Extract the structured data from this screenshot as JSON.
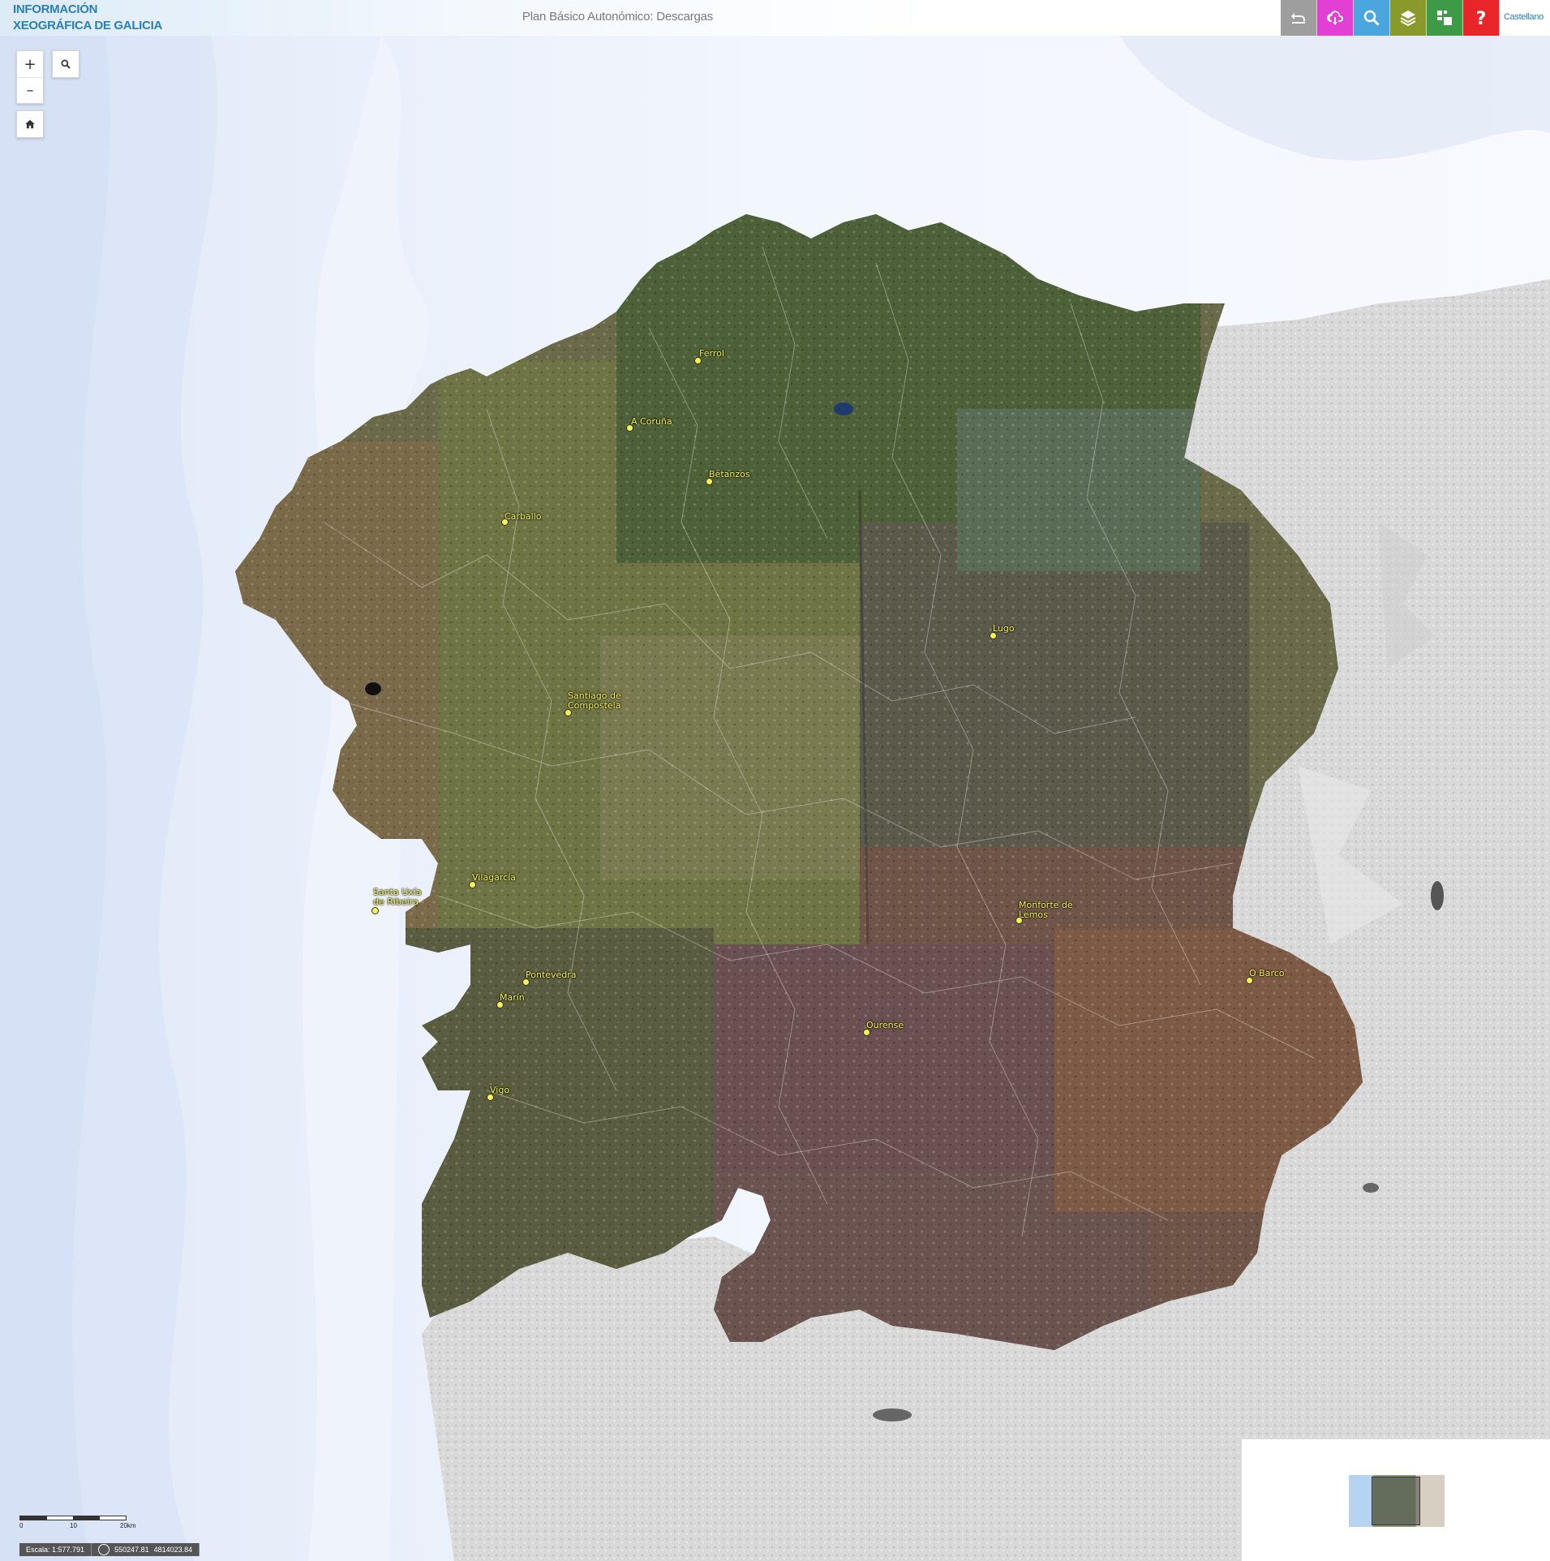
{
  "header": {
    "brand_line1": "INFORMACIÓN",
    "brand_line2": "XEOGRÁFICA DE GALICIA",
    "title": "Plan Básico Autonómico: Descargas",
    "language": "Castellano"
  },
  "toolbar": {
    "buttons": [
      {
        "name": "back-icon",
        "color": "#9e9e9e"
      },
      {
        "name": "cloud-download-icon",
        "color": "#e23fd4"
      },
      {
        "name": "search-icon",
        "color": "#4aa6dd"
      },
      {
        "name": "layers-icon",
        "color": "#8a9a2a"
      },
      {
        "name": "legend-icon",
        "color": "#3d9a45"
      },
      {
        "name": "help-icon",
        "color": "#e8262a"
      }
    ]
  },
  "map_controls": {
    "zoom_in": "+",
    "zoom_out": "–",
    "home_icon": "home-icon",
    "search_icon": "search-icon"
  },
  "cities": [
    {
      "name": "Ferrol"
    },
    {
      "name": "A Coruña"
    },
    {
      "name": "Betanzos"
    },
    {
      "name": "Carballo"
    },
    {
      "name": "Lugo"
    },
    {
      "name": "Santiago de Compostela"
    },
    {
      "name": "Vilagarcía"
    },
    {
      "name": "Santa Uxía de Ribeira"
    },
    {
      "name": "Monforte de Lemos"
    },
    {
      "name": "O Barco"
    },
    {
      "name": "Pontevedra"
    },
    {
      "name": "Marín"
    },
    {
      "name": "Ourense"
    },
    {
      "name": "Vigo"
    }
  ],
  "scale": {
    "tick_0": "0",
    "tick_1": "10",
    "tick_2": "20km",
    "label": "Escala: 1:577.791",
    "coord_x": "550247.81",
    "coord_y": "4814023.84"
  },
  "colors": {
    "brand": "#2a7fb8",
    "sea": "#e8eefa",
    "label": "#f7f34e"
  }
}
